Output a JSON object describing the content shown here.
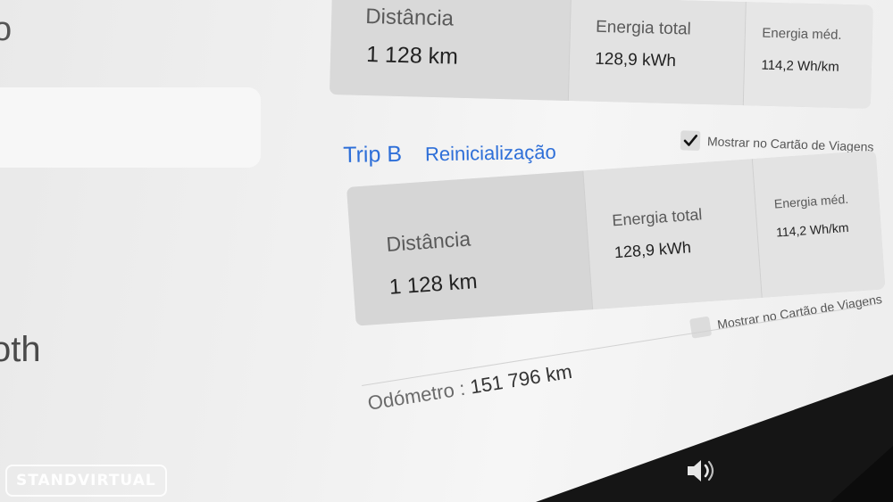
{
  "left_panel": {
    "top_label": "o",
    "bottom_label": "oth"
  },
  "trip_a": {
    "distance_label": "Distância",
    "distance_value": "1 128  km",
    "energy_total_label": "Energia total",
    "energy_total_value": "128,9 kWh",
    "energy_avg_label": "Energia méd.",
    "energy_avg_value": "114,2 Wh/km"
  },
  "trip_a_card_checkbox": {
    "label": "Mostrar no Cartão de Viagens",
    "checked": true
  },
  "trip_b": {
    "title": "Trip B",
    "reset_label": "Reinicialização",
    "distance_label": "Distância",
    "distance_value": "1 128  km",
    "energy_total_label": "Energia total",
    "energy_total_value": "128,9 kWh",
    "energy_avg_label": "Energia méd.",
    "energy_avg_value": "114,2 Wh/km"
  },
  "trip_b_card_checkbox": {
    "label": "Mostrar no Cartão de Viagens",
    "checked": false
  },
  "odometer": {
    "label": "Odómetro  :",
    "value": "151 796  km"
  },
  "watermark": {
    "text": "STANDVIRTUAL"
  },
  "icons": {
    "checkmark": "checkmark-icon",
    "speaker": "speaker-volume-icon"
  },
  "colors": {
    "accent_blue": "#2e6fd8"
  }
}
